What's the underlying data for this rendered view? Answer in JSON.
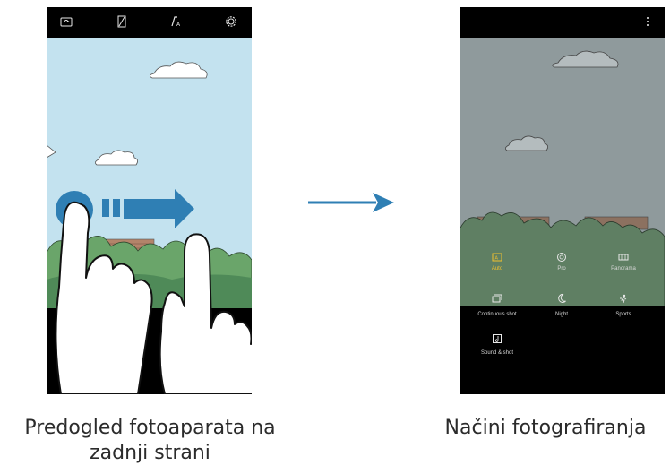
{
  "left_screen": {
    "top_icons": [
      "switch-camera-icon",
      "flash-off-icon",
      "filter-icon",
      "gear-icon"
    ],
    "gesture": "swipe-right",
    "caption_line1": "Predogled fotoaparata na",
    "caption_line2": "zadnji strani"
  },
  "right_screen": {
    "top_icons": [
      "more-options-icon"
    ],
    "modes": [
      {
        "label": "Auto",
        "icon": "auto-icon"
      },
      {
        "label": "Pro",
        "icon": "aperture-icon"
      },
      {
        "label": "Panorama",
        "icon": "panorama-icon"
      },
      {
        "label": "Continuous shot",
        "icon": "continuous-shot-icon"
      },
      {
        "label": "Night",
        "icon": "moon-icon"
      },
      {
        "label": "Sports",
        "icon": "sports-icon"
      },
      {
        "label": "Sound & shot",
        "icon": "sound-shot-icon"
      }
    ],
    "caption": "Načini fotografiranja"
  },
  "arrow_icon": "arrow-right-icon",
  "colors": {
    "accent_blue": "#2f7fb4",
    "sky": "#c3e2ef",
    "dim_sky": "#8f9a9c",
    "active_mode": "#f2c12e"
  }
}
